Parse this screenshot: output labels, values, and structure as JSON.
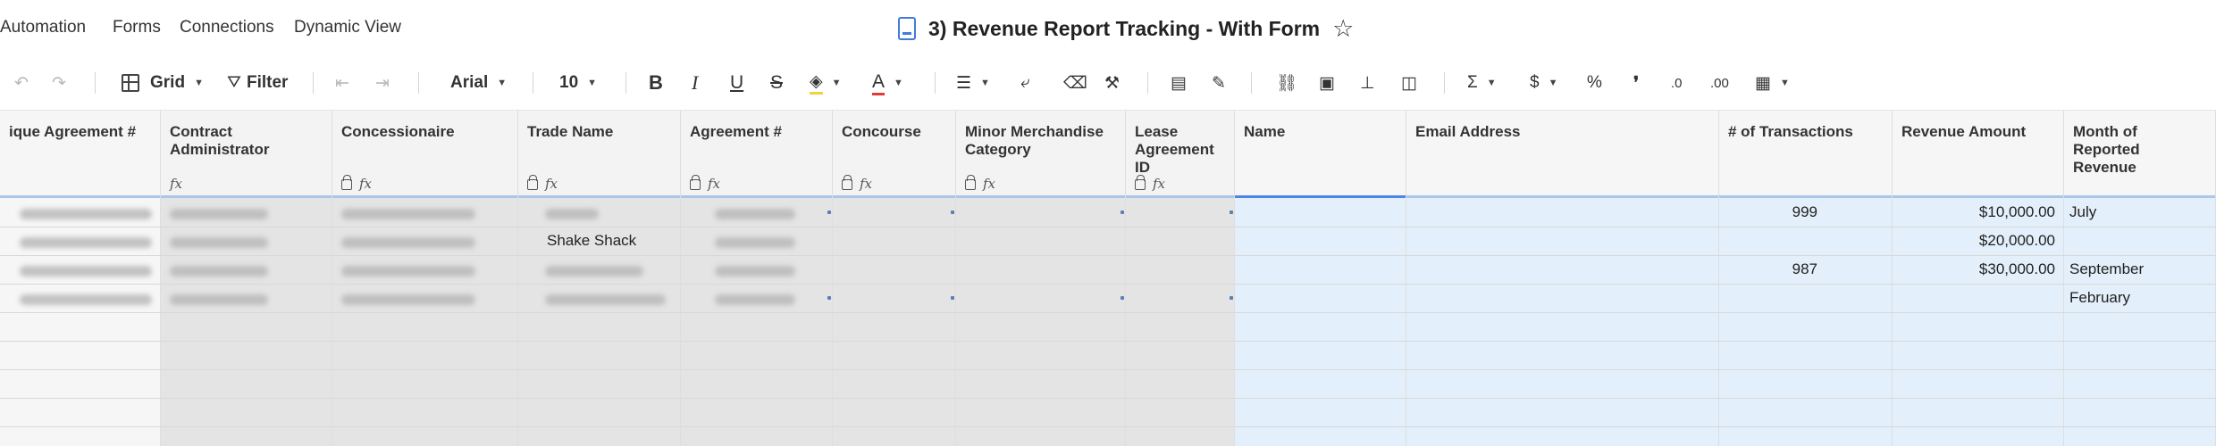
{
  "menu": {
    "automation": "Automation",
    "forms": "Forms",
    "connections": "Connections",
    "dynamic_view": "Dynamic View"
  },
  "document": {
    "title": "3) Revenue Report Tracking - With Form",
    "star_icon": "star-icon"
  },
  "toolbar": {
    "view_label": "Grid",
    "filter_label": "Filter",
    "font_label": "Arial",
    "size_label": "10",
    "bold": "B",
    "italic": "I",
    "underline": "U",
    "strike": "S",
    "text_color": "A",
    "sum": "Σ",
    "currency": "$",
    "percent": "%",
    "thousands": "❜",
    "dec_less": ".0",
    "dec_more": ".00"
  },
  "columns": [
    {
      "label": "ique Agreement #"
    },
    {
      "label": "Contract Administrator"
    },
    {
      "label": "Concessionaire"
    },
    {
      "label": "Trade Name"
    },
    {
      "label": "Agreement #"
    },
    {
      "label": "Concourse"
    },
    {
      "label": "Minor Merchandise Category"
    },
    {
      "label": "Lease Agreement ID"
    },
    {
      "label": "Name"
    },
    {
      "label": "Email Address"
    },
    {
      "label": "# of Transactions"
    },
    {
      "label": "Revenue Amount"
    },
    {
      "label": "Month of Reported Revenue"
    }
  ],
  "rows": [
    {
      "trade_name": "",
      "transactions": "999",
      "revenue": "$10,000.00",
      "month": "July"
    },
    {
      "trade_name": "Shake Shack",
      "transactions": "",
      "revenue": "$20,000.00",
      "month": ""
    },
    {
      "trade_name": "",
      "transactions": "987",
      "revenue": "$30,000.00",
      "month": "September"
    },
    {
      "trade_name": "",
      "transactions": "",
      "revenue": "",
      "month": "February"
    }
  ],
  "colors": {
    "gray_columns": "#e4e4e4",
    "blue_columns": "#e3effa",
    "accent": "#3f7be0"
  }
}
